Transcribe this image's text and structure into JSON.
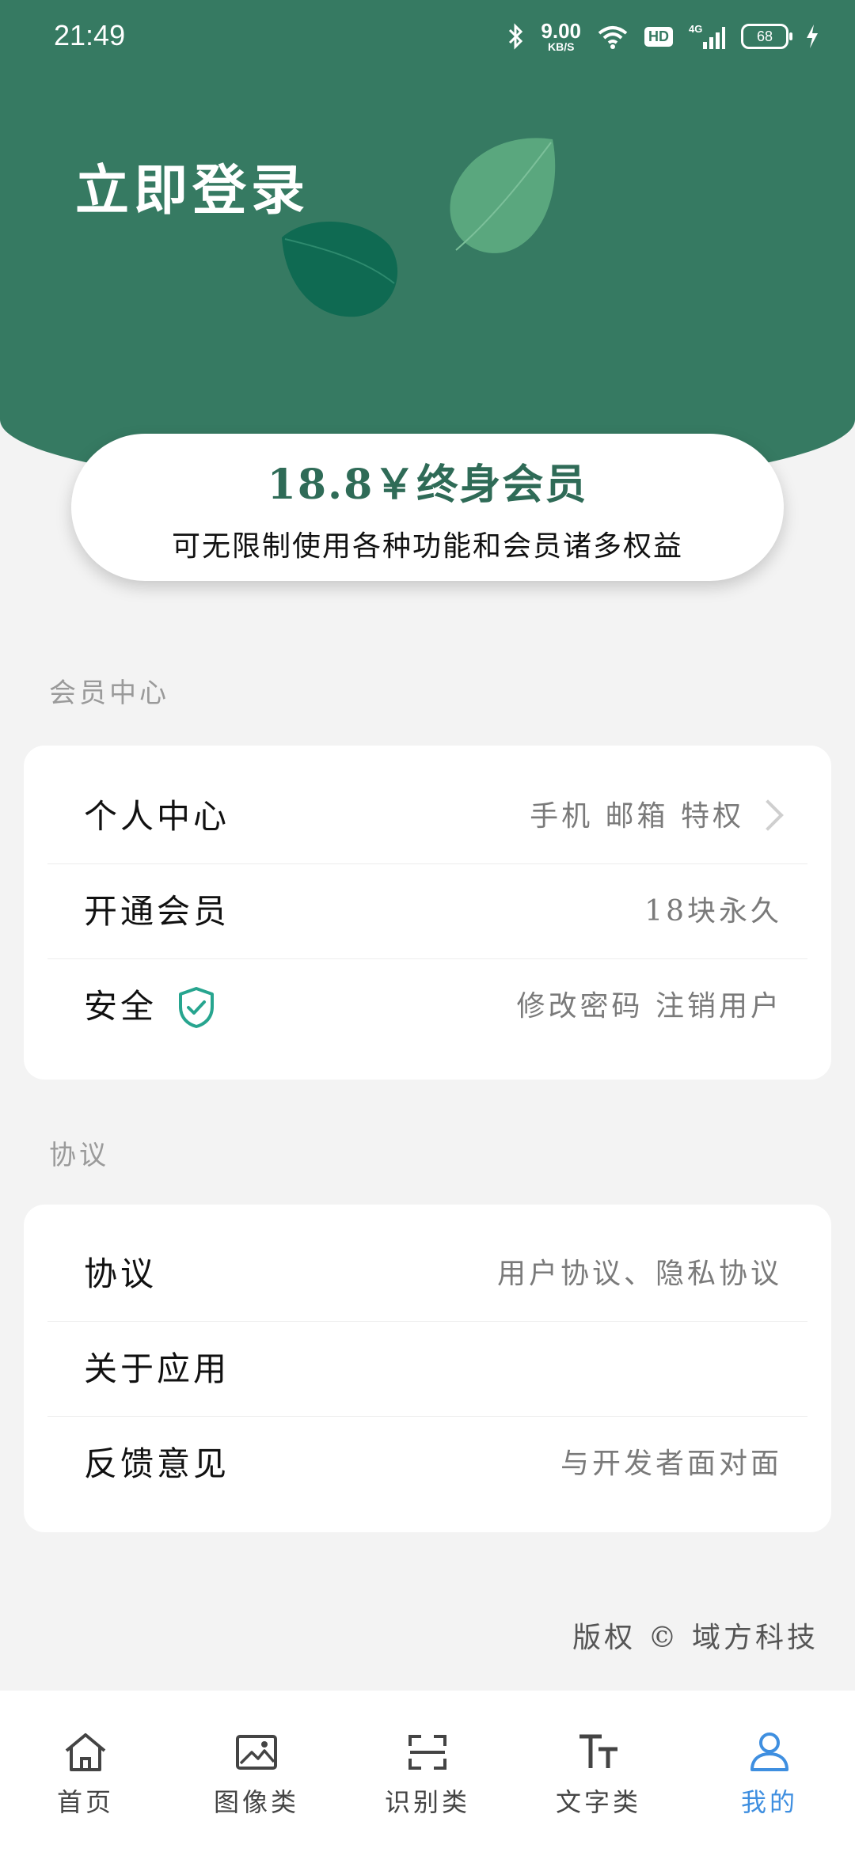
{
  "status_bar": {
    "time": "21:49",
    "net_speed_value": "9.00",
    "net_speed_unit": "KB/S",
    "hd": "HD",
    "signal": "4G",
    "battery": "68"
  },
  "header": {
    "login_title": "立即登录"
  },
  "vip_card": {
    "title": "18.8￥终身会员",
    "subtitle": "可无限制使用各种功能和会员诸多权益"
  },
  "member_section": {
    "label": "会员中心",
    "rows": [
      {
        "label": "个人中心",
        "value": "手机 邮箱 特权"
      },
      {
        "label": "开通会员",
        "value": "18块永久"
      },
      {
        "label": "安全",
        "value": "修改密码  注销用户"
      }
    ]
  },
  "agreement_section": {
    "label": "协议",
    "rows": [
      {
        "label": "协议",
        "value": "用户协议、隐私协议"
      },
      {
        "label": "关于应用",
        "value": ""
      },
      {
        "label": "反馈意见",
        "value": "与开发者面对面"
      }
    ]
  },
  "copyright": "版权 © 域方科技",
  "tabbar": {
    "tabs": [
      {
        "label": "首页",
        "icon": "home-icon"
      },
      {
        "label": "图像类",
        "icon": "image-icon"
      },
      {
        "label": "识别类",
        "icon": "scan-icon"
      },
      {
        "label": "文字类",
        "icon": "text-icon"
      },
      {
        "label": "我的",
        "icon": "user-icon"
      }
    ],
    "active_index": 4
  },
  "colors": {
    "header_green": "#367a62",
    "accent_blue": "#3f8fe0",
    "shield_teal": "#27a58f",
    "vip_title": "#2f6b57"
  }
}
